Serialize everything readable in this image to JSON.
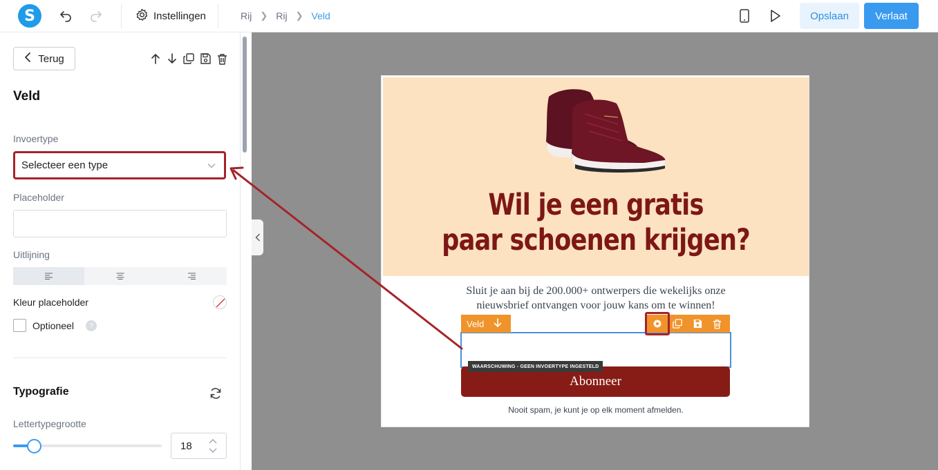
{
  "topbar": {
    "logo_letter": "S",
    "settings_label": "Instellingen",
    "breadcrumbs": [
      "Rij",
      "Rij",
      "Veld"
    ],
    "save_label": "Opslaan",
    "exit_label": "Verlaat"
  },
  "sidebar": {
    "back_label": "Terug",
    "title": "Veld",
    "input_type_label": "Invoertype",
    "input_type_value": "Selecteer een type",
    "placeholder_label": "Placeholder",
    "placeholder_value": "",
    "alignment_label": "Uitlijning",
    "alignment_selected": "left",
    "placeholder_color_label": "Kleur placeholder",
    "optional_label": "Optioneel",
    "optional_checked": false,
    "help_glyph": "?",
    "typography_title": "Typografie",
    "font_size_label": "Lettertypegrootte",
    "font_size_value": "18",
    "font_size_slider_fraction": 0.14
  },
  "popup": {
    "headline_line1": "Wil je een gratis",
    "headline_line2": "paar schoenen krijgen?",
    "subtext_line1": "Sluit je aan bij de 200.000+ ontwerpers die wekelijks onze",
    "subtext_line2": "nieuwsbrief ontvangen voor jouw kans om te winnen!",
    "field_tag_label": "Veld",
    "warning_text": "WAARSCHUWING - GEEN INVOERTYPE INGESTELD",
    "subscribe_label": "Abonneer",
    "footer_text": "Nooit spam, je kunt je op elk moment afmelden."
  },
  "colors": {
    "accent_blue": "#3a9af0",
    "highlight_red": "#a4242a",
    "hero_bg": "#fce2c0",
    "headline": "#7d1716",
    "button_bg": "#871c16",
    "toolbar_orange": "#f0932a"
  }
}
